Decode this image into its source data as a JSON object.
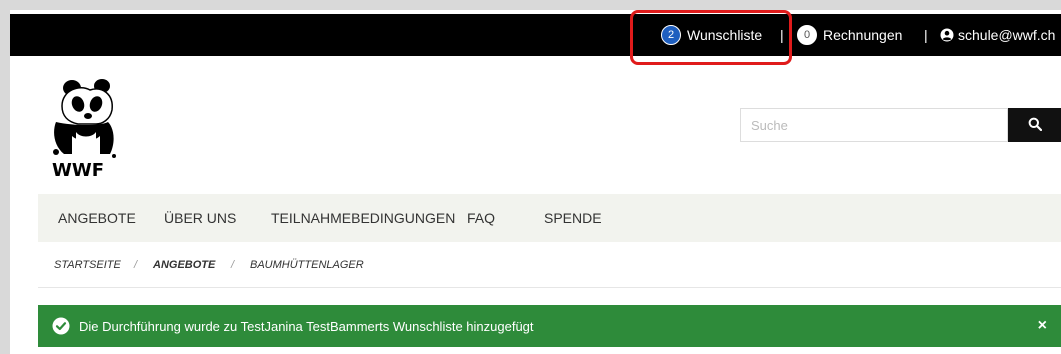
{
  "topbar": {
    "wishlist": {
      "count": "2",
      "label": "Wunschliste"
    },
    "separator": "|",
    "invoices": {
      "count": "0",
      "label": "Rechnungen"
    },
    "user": {
      "email": "schule@wwf.ch"
    }
  },
  "logo": {
    "text": "WWF"
  },
  "search": {
    "placeholder": "Suche",
    "value": ""
  },
  "nav": {
    "items": [
      {
        "label": "ANGEBOTE"
      },
      {
        "label": "ÜBER UNS"
      },
      {
        "label": "TEILNAHMEBEDINGUNGEN"
      },
      {
        "label": "FAQ"
      },
      {
        "label": "SPENDE"
      }
    ]
  },
  "breadcrumb": {
    "items": [
      {
        "label": "STARTSEITE"
      },
      {
        "label": "ANGEBOTE"
      },
      {
        "label": "BAUMHÜTTENLAGER"
      }
    ],
    "separator": "/"
  },
  "alert": {
    "message": "Die Durchführung wurde zu TestJanina TestBammerts Wunschliste hinzugefügt",
    "close": "×"
  },
  "colors": {
    "topbar": "#000000",
    "accent_badge": "#1f5fbf",
    "highlight": "#e01b1b",
    "success": "#2e8b3a",
    "nav_bg": "#f2f3ee"
  },
  "icons": {
    "search": "search-icon",
    "user": "user-circle-icon",
    "alert": "check-circle-icon",
    "close": "close-icon"
  }
}
